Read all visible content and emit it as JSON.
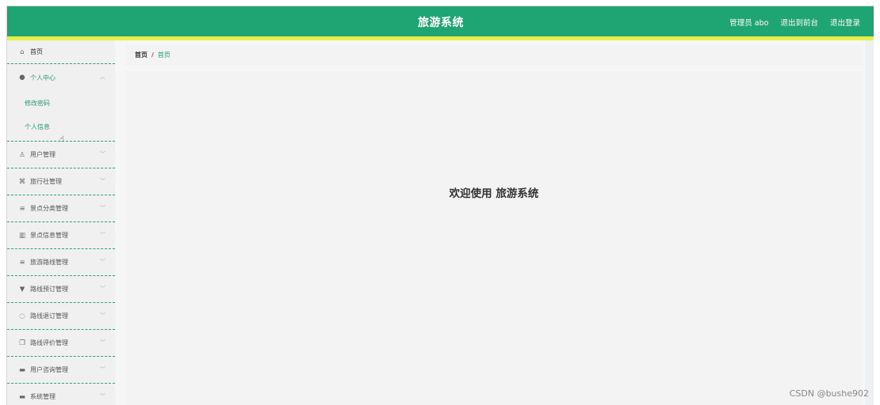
{
  "header": {
    "title": "旅游系统",
    "user_label": "管理员 abo",
    "back_front_label": "退出到前台",
    "logout_label": "退出登录"
  },
  "sidebar": {
    "home": {
      "label": "首页",
      "icon": "home-icon"
    },
    "personal_center": {
      "label": "个人中心",
      "icon": "user-icon",
      "sub_items": [
        {
          "label": "修改密码"
        },
        {
          "label": "个人信息"
        }
      ]
    },
    "items": [
      {
        "label": "用户管理",
        "icon": "user-manage-icon"
      },
      {
        "label": "旅行社管理",
        "icon": "agency-icon"
      },
      {
        "label": "景点分类管理",
        "icon": "list-icon"
      },
      {
        "label": "景点信息管理",
        "icon": "chart-icon"
      },
      {
        "label": "旅游路线管理",
        "icon": "list-icon"
      },
      {
        "label": "路线预订管理",
        "icon": "reserve-icon"
      },
      {
        "label": "路线退订管理",
        "icon": "cancel-icon"
      },
      {
        "label": "路线评价管理",
        "icon": "copy-icon"
      },
      {
        "label": "用户咨询管理",
        "icon": "message-icon"
      },
      {
        "label": "系统管理",
        "icon": "system-icon"
      }
    ]
  },
  "breadcrumb": {
    "home": "首页",
    "separator": "/",
    "current": "首页"
  },
  "main": {
    "welcome": "欢迎使用 旅游系统"
  },
  "watermark": "CSDN @bushe902",
  "colors": {
    "header": "#1fa473",
    "stripe": "#e6f044",
    "accent_text": "#2a9a6e"
  }
}
